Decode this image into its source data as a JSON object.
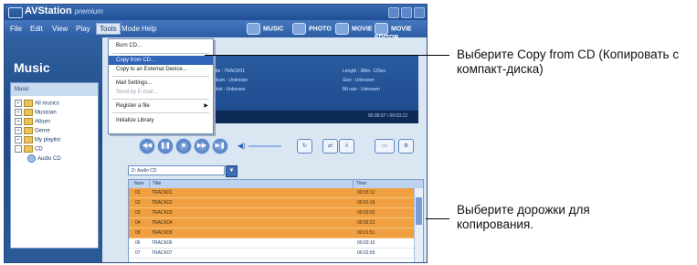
{
  "app": {
    "name": "AVStation",
    "edition": "premium"
  },
  "menubar": [
    "File",
    "Edit",
    "View",
    "Play",
    "Tools",
    "Mode",
    "Help"
  ],
  "nav_tabs": [
    "MUSIC",
    "PHOTO",
    "MOVIE",
    "MOVIE EDITOR"
  ],
  "sidebar": {
    "title": "Music",
    "panel_header": "Music",
    "tree": [
      {
        "label": "All musics",
        "expander": "+"
      },
      {
        "label": "Musician",
        "expander": "+"
      },
      {
        "label": "Album",
        "expander": "+"
      },
      {
        "label": "Genre",
        "expander": "+"
      },
      {
        "label": "My playlist",
        "expander": "+"
      },
      {
        "label": "CD",
        "expander": "-"
      },
      {
        "label": "Audio CD",
        "expander": ""
      }
    ]
  },
  "tools_menu": {
    "items": [
      {
        "label": "Burn CD..."
      },
      {
        "label": "Copy from CD...",
        "highlighted": true
      },
      {
        "label": "Copy to an External Device..."
      },
      {
        "label": "Mail Settings..."
      },
      {
        "label": "Send by E-mail...",
        "disabled": true
      },
      {
        "label": "Register a file",
        "submenu": true
      },
      {
        "label": "Initialize Library"
      }
    ]
  },
  "info": {
    "title": "Title : TRACK01",
    "album": "Album : Unknown",
    "artist": "Artist : Unknown",
    "length": "Length : 3Min. 12Sec.",
    "size": "Size : Unknown",
    "bitrate": "Bit rate : Unknown",
    "time": "00:00:07 / 00:03:12"
  },
  "drive": {
    "selected": "D: Audio CD"
  },
  "table": {
    "headers": [
      "Num",
      "Title",
      "Time"
    ],
    "rows": [
      {
        "num": "01",
        "title": "TRACK01",
        "time": "00:03:12",
        "selected": true
      },
      {
        "num": "02",
        "title": "TRACK02",
        "time": "00:01:19",
        "selected": true
      },
      {
        "num": "03",
        "title": "TRACK03",
        "time": "00:03:02",
        "selected": true
      },
      {
        "num": "04",
        "title": "TRACK04",
        "time": "00:02:21",
        "selected": true
      },
      {
        "num": "05",
        "title": "TRACK05",
        "time": "00:01:51",
        "selected": true
      },
      {
        "num": "06",
        "title": "TRACK06",
        "time": "00:03:10",
        "selected": false
      },
      {
        "num": "07",
        "title": "TRACK07",
        "time": "00:02:59",
        "selected": false
      }
    ]
  },
  "callouts": {
    "copy_from_cd": "Выберите Copy from CD (Копировать с компакт-диска)",
    "select_tracks": "Выберите дорожки для копирования."
  },
  "colors": {
    "selected_row": "#f0a040",
    "accent": "#2f64b8"
  }
}
